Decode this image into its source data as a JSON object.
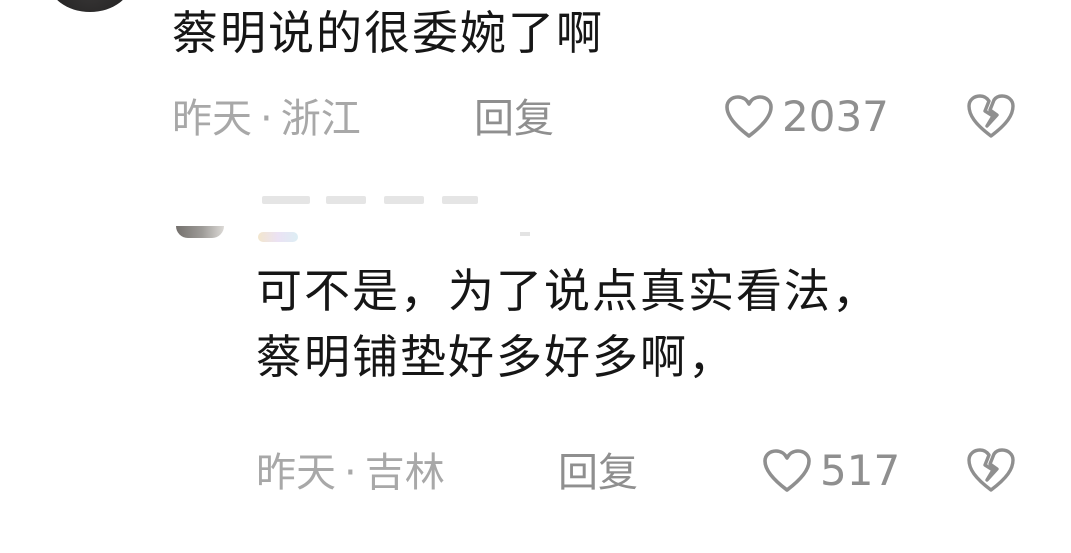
{
  "comments": [
    {
      "text_lines": [
        "蔡明说的很委婉了啊"
      ],
      "time": "昨天",
      "separator": "·",
      "location": "浙江",
      "reply_label": "回复",
      "likes": "2037"
    },
    {
      "text_lines": [
        "可不是，为了说点真实看法，",
        "蔡明铺垫好多好多啊，"
      ],
      "time": "昨天",
      "separator": "·",
      "location": "吉林",
      "reply_label": "回复",
      "likes": "517"
    }
  ],
  "icons": {
    "like": "heart-outline-icon",
    "dislike": "broken-heart-icon"
  },
  "colors": {
    "text": "#161616",
    "meta": "#a8a8a8",
    "action": "#8f8f8f"
  }
}
